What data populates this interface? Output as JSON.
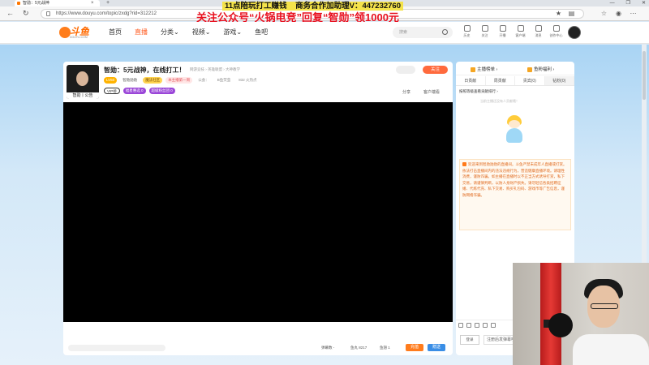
{
  "browser": {
    "tab_title": "智勋：5元战神",
    "tab_close": "×",
    "tab_new": "+",
    "window_controls": [
      "—",
      "❐",
      "✕"
    ],
    "url": "https://www.douyu.com/topic/zxdg?rid=312212",
    "back": "←",
    "refresh": "↻"
  },
  "promo": {
    "line1_a": "11点陪玩打工赚钱",
    "line1_b": "商务合作加助理V：447232760",
    "line2": "关注公众号“火锅电竞”回复“智勋”领1000元"
  },
  "site": {
    "logo_text": "斗鱼",
    "logo_sub": "DOUYU.COM",
    "nav": [
      "首页",
      "直播",
      "分类⌄",
      "视频⌄",
      "游戏⌄",
      "鱼吧"
    ],
    "search_placeholder": "搜索",
    "header_icons": [
      "历史",
      "关注",
      "开播",
      "客户端",
      "消息",
      "创作中心"
    ]
  },
  "room": {
    "title": "智勋：5元战神，在线打工！",
    "category": "网游竞技 › 英雄联盟 › 大神教学",
    "avatar_caption": "智勋丨公告",
    "anchor_level": "LV50",
    "anchor_name": "智勋勋勋",
    "tag_yellow": "魔法社区",
    "tag_pink": "本主播第一周",
    "tag_public": "公会：",
    "public_name": "B鱼荧萤",
    "hot": "832 火热点",
    "tags2": [
      "VIP榜",
      "福星惠选 0",
      "超级粉丝团 0"
    ],
    "follow": "关注",
    "share": "分享",
    "report": "客户端看"
  },
  "bottom_bar": {
    "barrage": "弹幕数 -",
    "fish": "鱼丸 8217",
    "fishbar": "鱼翅 1",
    "recharge": "充值",
    "gift": "赠送"
  },
  "side": {
    "top_left": "主播榜单 ›",
    "top_right": "鱼粉福利 ›",
    "tabs": [
      "日贡献",
      "周贡献",
      "贵宾(0)",
      "钻粉(0)"
    ],
    "sub_title": "按照等级查看贡献排行 ›",
    "empty_hint": "当前主播还没有人贡献哦！",
    "notice": "欢迎来到智勋勋勋的直播间。斗鱼严禁未成年人直播或打赏。依法打击直播间内的违法违规行为，营造健康直播环境。请理性消费，谨防诈骗。如主播在直播时以不正当方式诱导打赏，私下交易，请谨慎判断，以防人身财产损失。请勿轻信各类招聘征婚、代练代充、私下交易、购买礼包码、游戏币等广告信息，谨防网络诈骗。",
    "login": "登录",
    "input": "注册后发弹幕哦~",
    "level_chip": "0"
  }
}
